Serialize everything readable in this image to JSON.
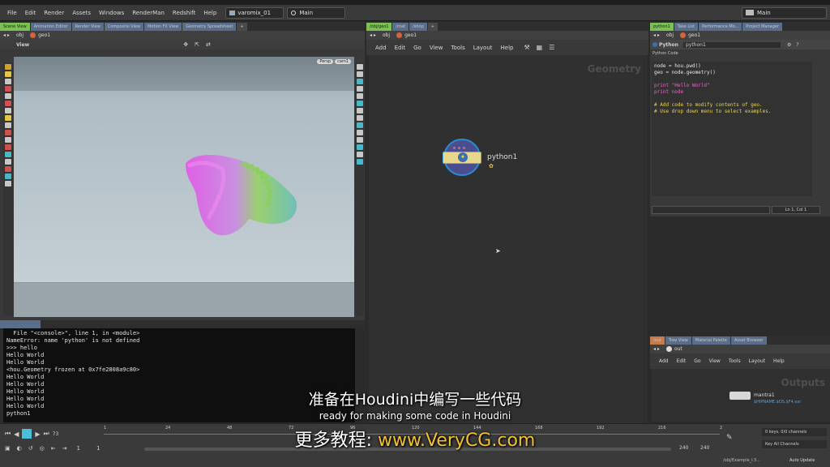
{
  "menubar": {
    "items": [
      "File",
      "Edit",
      "Render",
      "Assets",
      "Windows",
      "RenderMan",
      "Redshift",
      "Help"
    ],
    "desktop": "varomix_01",
    "context": "Main",
    "right_context": "Main"
  },
  "left_pane": {
    "tabs": [
      "Scene View",
      "Animation Editor",
      "Render View",
      "Composite View",
      "Motion FX View",
      "Geometry Spreadsheet"
    ],
    "path": [
      "obj",
      "geo1"
    ],
    "view_label": "View",
    "persp": "Persp",
    "cam": "cam1"
  },
  "shell": {
    "lines": [
      "  File \"<console>\", line 1, in <module>",
      "NameError: name 'python' is not defined",
      ">>> hello",
      "Hello World",
      "Hello World",
      "<hou.Geometry frozen at 0x7fe2808a9c80>",
      "Hello World",
      "Hello World",
      "Hello World",
      "Hello World",
      "Hello World",
      "python1"
    ]
  },
  "network": {
    "tabs": [
      "/obj/geo1",
      "/mat",
      "/shop"
    ],
    "path": [
      "obj",
      "geo1"
    ],
    "menu": [
      "Add",
      "Edit",
      "Go",
      "View",
      "Tools",
      "Layout",
      "Help"
    ],
    "context_label": "Geometry",
    "node_name": "python1"
  },
  "params": {
    "tabs": [
      "python1",
      "Take List",
      "Performance Mo...",
      "Project Manager"
    ],
    "path": [
      "obj",
      "geo1"
    ],
    "node_type": "Python",
    "node_name": "python1",
    "code_label": "Python Code",
    "code": [
      {
        "t": "node = hou.pwd()",
        "c": "white"
      },
      {
        "t": "geo = node.geometry()",
        "c": "white"
      },
      {
        "t": "",
        "c": "white"
      },
      {
        "t": "print \"Hello World\"",
        "c": "pink"
      },
      {
        "t": "print node",
        "c": "pink"
      },
      {
        "t": "",
        "c": "white"
      },
      {
        "t": "# Add code to modify contents of geo.",
        "c": "yellow"
      },
      {
        "t": "# Use drop down menu to select examples.",
        "c": "yellow"
      }
    ],
    "cursor_pos": "Ln 1, Col 1"
  },
  "out_pane": {
    "tabs": [
      "/out",
      "Tree View",
      "Material Palette",
      "Asset Browser"
    ],
    "path": "out",
    "menu": [
      "Add",
      "Edit",
      "Go",
      "View",
      "Tools",
      "Layout",
      "Help"
    ],
    "context_label": "Outputs",
    "node_name": "mantra1",
    "node_file": "$HIPNAME.$OS.$F4.exr"
  },
  "timeline": {
    "frame": "73",
    "ticks": [
      "1",
      "24",
      "48",
      "72",
      "96",
      "120",
      "144",
      "168",
      "192",
      "216",
      "2"
    ],
    "start": "1",
    "start2": "1",
    "end": "240",
    "end2": "240",
    "keys": "0 keys, 0/0 channels",
    "key_all": "Key All Channels",
    "status_path": "/obj/Example_I.5...",
    "auto_update": "Auto Update"
  },
  "subtitles": {
    "cn": "准备在Houdini中编写一些代码",
    "en": "ready for making some code in Houdini",
    "promo": "更多教程: www.VeryCG.com"
  },
  "colors": {
    "selected_tab": "#7cbf55",
    "tab": "#5a6e8c",
    "promo_accent": "#f2c230",
    "node_body": "#7a7ab8"
  }
}
